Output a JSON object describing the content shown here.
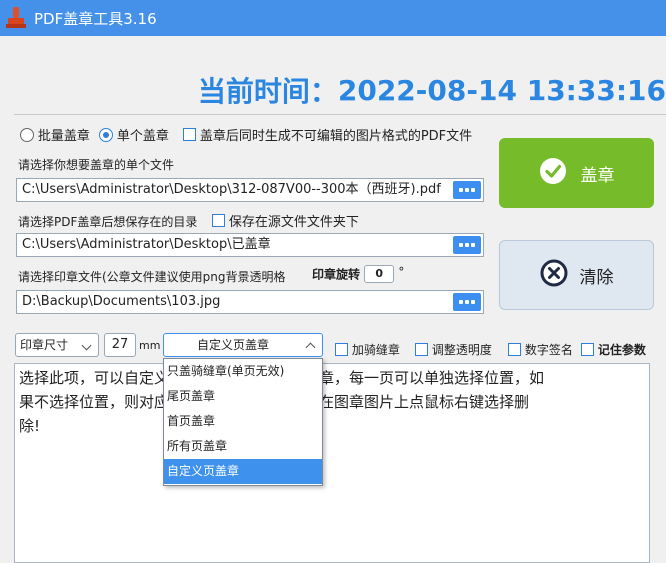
{
  "window": {
    "title": "PDF盖章工具3.16"
  },
  "time": {
    "label": "当前时间：",
    "value": "2022-08-14 13:33:16"
  },
  "mode": {
    "batch_label": "批量盖章",
    "single_label": "单个盖章",
    "selected": "single",
    "image_pdf_label": "盖章后同时生成不可编辑的图片格式的PDF文件"
  },
  "file": {
    "hint": "请选择你想要盖章的单个文件",
    "path": "C:\\Users\\Administrator\\Desktop\\312-087V00--300本（西班牙).pdf"
  },
  "save": {
    "hint": "请选择PDF盖章后想保存在的目录",
    "same_folder_label": "保存在源文件文件夹下",
    "path": "C:\\Users\\Administrator\\Desktop\\已盖章"
  },
  "stamp": {
    "hint": "请选择印章文件(公章文件建议使用png背景透明格",
    "rotate_label": "印章旋转",
    "rotate_value": "0",
    "rotate_unit": "°",
    "path": "D:\\Backup\\Documents\\103.jpg"
  },
  "buttons": {
    "seal": "盖章",
    "clear": "清除"
  },
  "options": {
    "size_combo": "印章尺寸",
    "size_value": "27",
    "size_unit": "mm",
    "mode_combo": "自定义页盖章",
    "seam_label": "加骑缝章",
    "opacity_label": "调整透明度",
    "digital_sig_label": "数字签名",
    "remember_label": "记住参数"
  },
  "dropdown": {
    "items": [
      "只盖骑缝章(单页无效)",
      "尾页盖章",
      "首页盖章",
      "所有页盖章",
      "自定义页盖章"
    ],
    "selected_index": 4
  },
  "description": {
    "line1": "选择此项，可以自定义每一页在不同的位置盖章，每一页可以单独选择位置，如",
    "line2": "果不选择位置，则对应页不盖章，选错，可以在图章图片上点鼠标右键选择删",
    "line3": "除!"
  },
  "colors": {
    "titlebar": "#4590e8",
    "time": "#2a86e0",
    "seal_button": "#76bb2a",
    "selection": "#3f91ee"
  }
}
